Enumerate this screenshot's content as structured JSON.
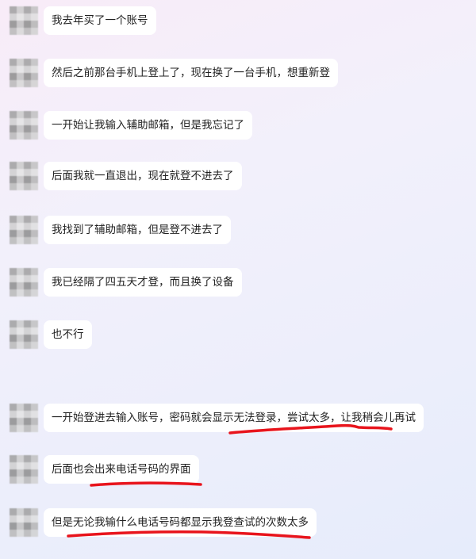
{
  "conversation": {
    "messages": [
      {
        "text": "我去年买了一个账号"
      },
      {
        "text": "然后之前那台手机上登上了，现在换了一台手机，想重新登"
      },
      {
        "text": "一开始让我输入辅助邮箱，但是我忘记了"
      },
      {
        "text": "后面我就一直退出，现在就登不进去了"
      },
      {
        "text": "我找到了辅助邮箱，但是登不进去了"
      },
      {
        "text": "我已经隔了四五天才登，而且换了设备"
      },
      {
        "text": "也不行"
      },
      {
        "text": "一开始登进去输入账号，密码就会显示无法登录，尝试太多，让我稍会儿再试"
      },
      {
        "text": "后面也会出来电话号码的界面"
      },
      {
        "text": "但是无论我输什么电话号码都显示我登查试的次数太多"
      }
    ]
  },
  "annotation": {
    "color": "#e8141c"
  }
}
